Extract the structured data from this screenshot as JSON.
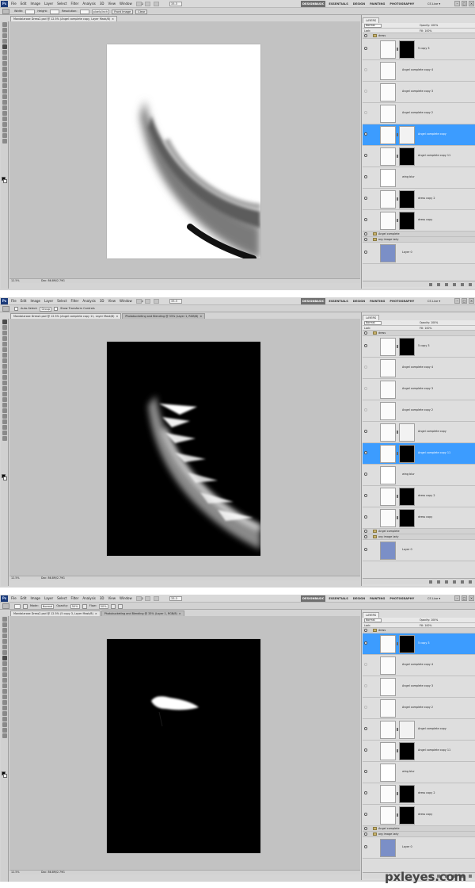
{
  "app": {
    "logo": "Ps",
    "zoom_box": "33.3"
  },
  "menus": [
    "File",
    "Edit",
    "Image",
    "Layer",
    "Select",
    "Filter",
    "Analysis",
    "3D",
    "View",
    "Window",
    "Help"
  ],
  "workspaces": [
    "DESIGNBASIC",
    "ESSENTIALS",
    "DESIGN",
    "PAINTING",
    "PHOTOGRAPHY"
  ],
  "cslive": "CS Live ▾",
  "window_buttons": [
    "–",
    "□",
    "×"
  ],
  "colors": {
    "selection": "#3c9cff",
    "chrome": "#d4d4d4",
    "canvas_bg": "#c2c2c2"
  },
  "shots": [
    {
      "options": {
        "style_label": "Style:",
        "style_value": "Normal",
        "width_label": "Width:",
        "height_label": "Height:",
        "resolution_label": "Resolution:",
        "resolution_unit": "pixels/inch",
        "front_image_btn": "Front Image",
        "clear_btn": "Clear"
      },
      "tabs": [
        {
          "label": "Mandalarose Dress2.psd @ 12.5% (Angel complete copy, Layer Mask/8)"
        }
      ],
      "status": {
        "zoom": "12.5%",
        "doc": "Doc: 86.8M/2.79G"
      },
      "doc_bg": "white",
      "layers": [
        {
          "kind": "group",
          "name": "dress"
        },
        {
          "kind": "layer",
          "name": "5 copy 3",
          "mask": true,
          "eye": true
        },
        {
          "kind": "layer",
          "name": "Angel complete copy 4",
          "mask": false,
          "eye": false
        },
        {
          "kind": "layer",
          "name": "Angel complete copy 3",
          "mask": false,
          "eye": false
        },
        {
          "kind": "layer",
          "name": "Angel complete copy 2",
          "mask": false,
          "eye": false
        },
        {
          "kind": "layer",
          "name": "Angel complete copy",
          "mask": true,
          "eye": true,
          "selected": true
        },
        {
          "kind": "layer",
          "name": "Angel complete copy 11",
          "mask": true,
          "eye": true
        },
        {
          "kind": "layer",
          "name": "wing blur",
          "mask": false,
          "eye": true,
          "white": true
        },
        {
          "kind": "layer",
          "name": "dress copy 2",
          "mask": true,
          "eye": true
        },
        {
          "kind": "layer",
          "name": "dress copy",
          "mask": true,
          "eye": true
        },
        {
          "kind": "group",
          "name": "Angel complete"
        },
        {
          "kind": "group",
          "name": "org image lady"
        },
        {
          "kind": "layer",
          "name": "Layer 0",
          "mask": false,
          "eye": true,
          "photo": true
        }
      ]
    },
    {
      "options": {
        "auto_select_label": "Auto-Select:",
        "auto_select_value": "Group",
        "show_transform_label": "Show Transform Controls"
      },
      "tabs": [
        {
          "label": "Mandalarose Dress2.psd @ 12.5% (Angel complete copy 11, Layer Mask/8)"
        },
        {
          "label": "Photobucketing and Blending @ 33% (Layer 1, RGB/8)"
        }
      ],
      "status": {
        "zoom": "12.5%",
        "doc": "Doc: 86.8M/2.79G"
      },
      "doc_bg": "black",
      "layers": [
        {
          "kind": "group",
          "name": "dress"
        },
        {
          "kind": "layer",
          "name": "5 copy 3",
          "mask": true,
          "eye": true
        },
        {
          "kind": "layer",
          "name": "Angel complete copy 4",
          "mask": false,
          "eye": false
        },
        {
          "kind": "layer",
          "name": "Angel complete copy 3",
          "mask": false,
          "eye": false
        },
        {
          "kind": "layer",
          "name": "Angel complete copy 2",
          "mask": false,
          "eye": false
        },
        {
          "kind": "layer",
          "name": "Angel complete copy",
          "mask": true,
          "eye": true
        },
        {
          "kind": "layer",
          "name": "Angel complete copy 11",
          "mask": true,
          "eye": true,
          "selected": true
        },
        {
          "kind": "layer",
          "name": "wing blur",
          "mask": false,
          "eye": true,
          "white": true
        },
        {
          "kind": "layer",
          "name": "dress copy 2",
          "mask": true,
          "eye": true
        },
        {
          "kind": "layer",
          "name": "dress copy",
          "mask": true,
          "eye": true
        },
        {
          "kind": "group",
          "name": "Angel complete"
        },
        {
          "kind": "group",
          "name": "org image lady"
        },
        {
          "kind": "layer",
          "name": "Layer 0",
          "mask": false,
          "eye": true,
          "photo": true
        }
      ]
    },
    {
      "options": {
        "mode_label": "Mode:",
        "mode_value": "Normal",
        "opacity_label": "Opacity:",
        "opacity_value": "50%",
        "flow_label": "Flow:",
        "flow_value": "50%"
      },
      "tabs": [
        {
          "label": "Mandalarose Dress2.psd @ 12.5% (5 copy 3, Layer Mask/8)"
        },
        {
          "label": "Photobucketing and Blending @ 33% (Layer 1, RGB/8)"
        }
      ],
      "status": {
        "zoom": "12.5%",
        "doc": "Doc: 86.8M/2.79G"
      },
      "doc_bg": "black",
      "layers": [
        {
          "kind": "group",
          "name": "dress"
        },
        {
          "kind": "layer",
          "name": "5 copy 3",
          "mask": true,
          "eye": true,
          "selected": true
        },
        {
          "kind": "layer",
          "name": "Angel complete copy 4",
          "mask": false,
          "eye": false
        },
        {
          "kind": "layer",
          "name": "Angel complete copy 3",
          "mask": false,
          "eye": false
        },
        {
          "kind": "layer",
          "name": "Angel complete copy 2",
          "mask": false,
          "eye": false
        },
        {
          "kind": "layer",
          "name": "Angel complete copy",
          "mask": true,
          "eye": true
        },
        {
          "kind": "layer",
          "name": "Angel complete copy 11",
          "mask": true,
          "eye": true
        },
        {
          "kind": "layer",
          "name": "wing blur",
          "mask": false,
          "eye": true,
          "white": true
        },
        {
          "kind": "layer",
          "name": "dress copy 2",
          "mask": true,
          "eye": true
        },
        {
          "kind": "layer",
          "name": "dress copy",
          "mask": true,
          "eye": true
        },
        {
          "kind": "group",
          "name": "Angel complete"
        },
        {
          "kind": "group",
          "name": "org image lady"
        },
        {
          "kind": "layer",
          "name": "Layer 0",
          "mask": false,
          "eye": true,
          "photo": true
        }
      ]
    }
  ],
  "layers_panel": {
    "tabs": [
      "LAYERS"
    ],
    "blend_mode": "Normal",
    "opacity_label": "Opacity: 100%",
    "lock_label": "Lock:",
    "fill_label": "Fill: 100%"
  },
  "watermark": "pxleyes.com"
}
